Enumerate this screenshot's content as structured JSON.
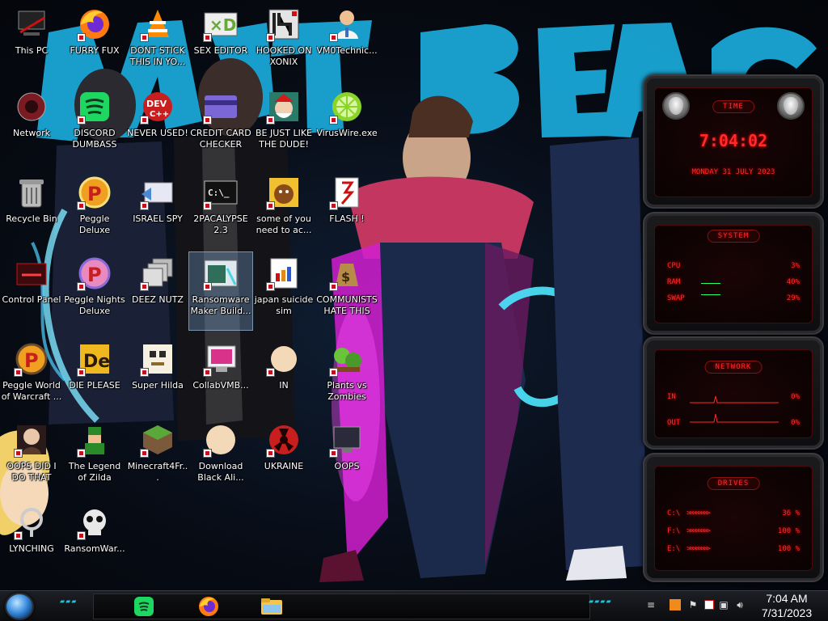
{
  "desktop": {
    "icons": [
      {
        "id": "this-pc",
        "label": "This PC"
      },
      {
        "id": "furry-fux",
        "label": "FURRY FUX"
      },
      {
        "id": "dont-stick",
        "label": "DONT STICK THIS IN YO..."
      },
      {
        "id": "sex-editor",
        "label": "SEX EDITOR"
      },
      {
        "id": "hooked-on-xonix",
        "label": "HOOKED ON XONIX"
      },
      {
        "id": "vm0technic",
        "label": "VM0Technic..."
      },
      {
        "id": "network",
        "label": "Network"
      },
      {
        "id": "discord-dumbass",
        "label": "DISCORD DUMBASS"
      },
      {
        "id": "never-used",
        "label": "NEVER USED!"
      },
      {
        "id": "credit-card",
        "label": "CREDIT CARD CHECKER"
      },
      {
        "id": "be-just-like",
        "label": "BE JUST LIKE THE DUDE!"
      },
      {
        "id": "viruswire",
        "label": "VirusWire.exe"
      },
      {
        "id": "recycle-bin",
        "label": "Recycle Bin"
      },
      {
        "id": "peggle-deluxe",
        "label": "Peggle Deluxe"
      },
      {
        "id": "israel-spy",
        "label": "ISRAEL SPY"
      },
      {
        "id": "2pacalypse",
        "label": "2PACALYPSE 2.3"
      },
      {
        "id": "some-of-you",
        "label": "some of you need to ac..."
      },
      {
        "id": "flash",
        "label": "FLASH !"
      },
      {
        "id": "control-panel",
        "label": "Control Panel"
      },
      {
        "id": "peggle-nights",
        "label": "Peggle Nights Deluxe"
      },
      {
        "id": "deez-nutz",
        "label": "DEEZ NUTZ"
      },
      {
        "id": "ransomware-maker",
        "label": "Ransomware Maker Build..."
      },
      {
        "id": "japan-suicide",
        "label": "japan suicide sim"
      },
      {
        "id": "communists",
        "label": "COMMUNISTS HATE THIS G..."
      },
      {
        "id": "peggle-world",
        "label": "Peggle World of Warcraft ..."
      },
      {
        "id": "die-please",
        "label": "DIE PLEASE"
      },
      {
        "id": "super-hilda",
        "label": "Super Hilda"
      },
      {
        "id": "collabvmb",
        "label": "CollabVMB..."
      },
      {
        "id": "star-in",
        "label": "IN"
      },
      {
        "id": "plants-vs-zombies",
        "label": "Plants vs Zombies"
      },
      {
        "id": "oops-did-i",
        "label": "OOPS DID I DO THAT"
      },
      {
        "id": "legend-of-zilda",
        "label": "The Legend of Zilda"
      },
      {
        "id": "minecraft4fr",
        "label": "Minecraft4Fr..."
      },
      {
        "id": "download-black",
        "label": "Download Black Ali..."
      },
      {
        "id": "ukraine",
        "label": "UKRAINE"
      },
      {
        "id": "oops",
        "label": "OOPS"
      },
      {
        "id": "lynching",
        "label": "LYNCHING"
      },
      {
        "id": "ransomwar",
        "label": "RansomWar..."
      }
    ]
  },
  "widgets": {
    "time": {
      "title": "TIME",
      "clock": "7:04:02",
      "date": "MONDAY 31 JULY 2023"
    },
    "system": {
      "title": "SYSTEM",
      "rows": [
        {
          "label": "CPU",
          "value": "3%"
        },
        {
          "label": "RAM",
          "value": "40%"
        },
        {
          "label": "SWAP",
          "value": "29%"
        }
      ]
    },
    "network": {
      "title": "NETWORK",
      "rows": [
        {
          "label": "IN",
          "value": "0%"
        },
        {
          "label": "OUT",
          "value": "0%"
        }
      ]
    },
    "drives": {
      "title": "DRIVES",
      "rows": [
        {
          "label": "C:\\",
          "value": "36 %"
        },
        {
          "label": "F:\\",
          "value": "100 %"
        },
        {
          "label": "E:\\",
          "value": "100 %"
        }
      ]
    }
  },
  "taskbar": {
    "start_icon": "windows-orb",
    "pinned": [
      {
        "id": "spotify",
        "icon": "spotify-icon"
      },
      {
        "id": "firefox",
        "icon": "firefox-icon"
      },
      {
        "id": "explorer",
        "icon": "folder-icon"
      }
    ],
    "clock_time": "7:04 AM",
    "clock_date": "7/31/2023"
  },
  "colors": {
    "accent_red": "#ff2a2a",
    "accent_cyan": "#1fc3dc",
    "wallpaper_text": "#1aa6d6"
  }
}
